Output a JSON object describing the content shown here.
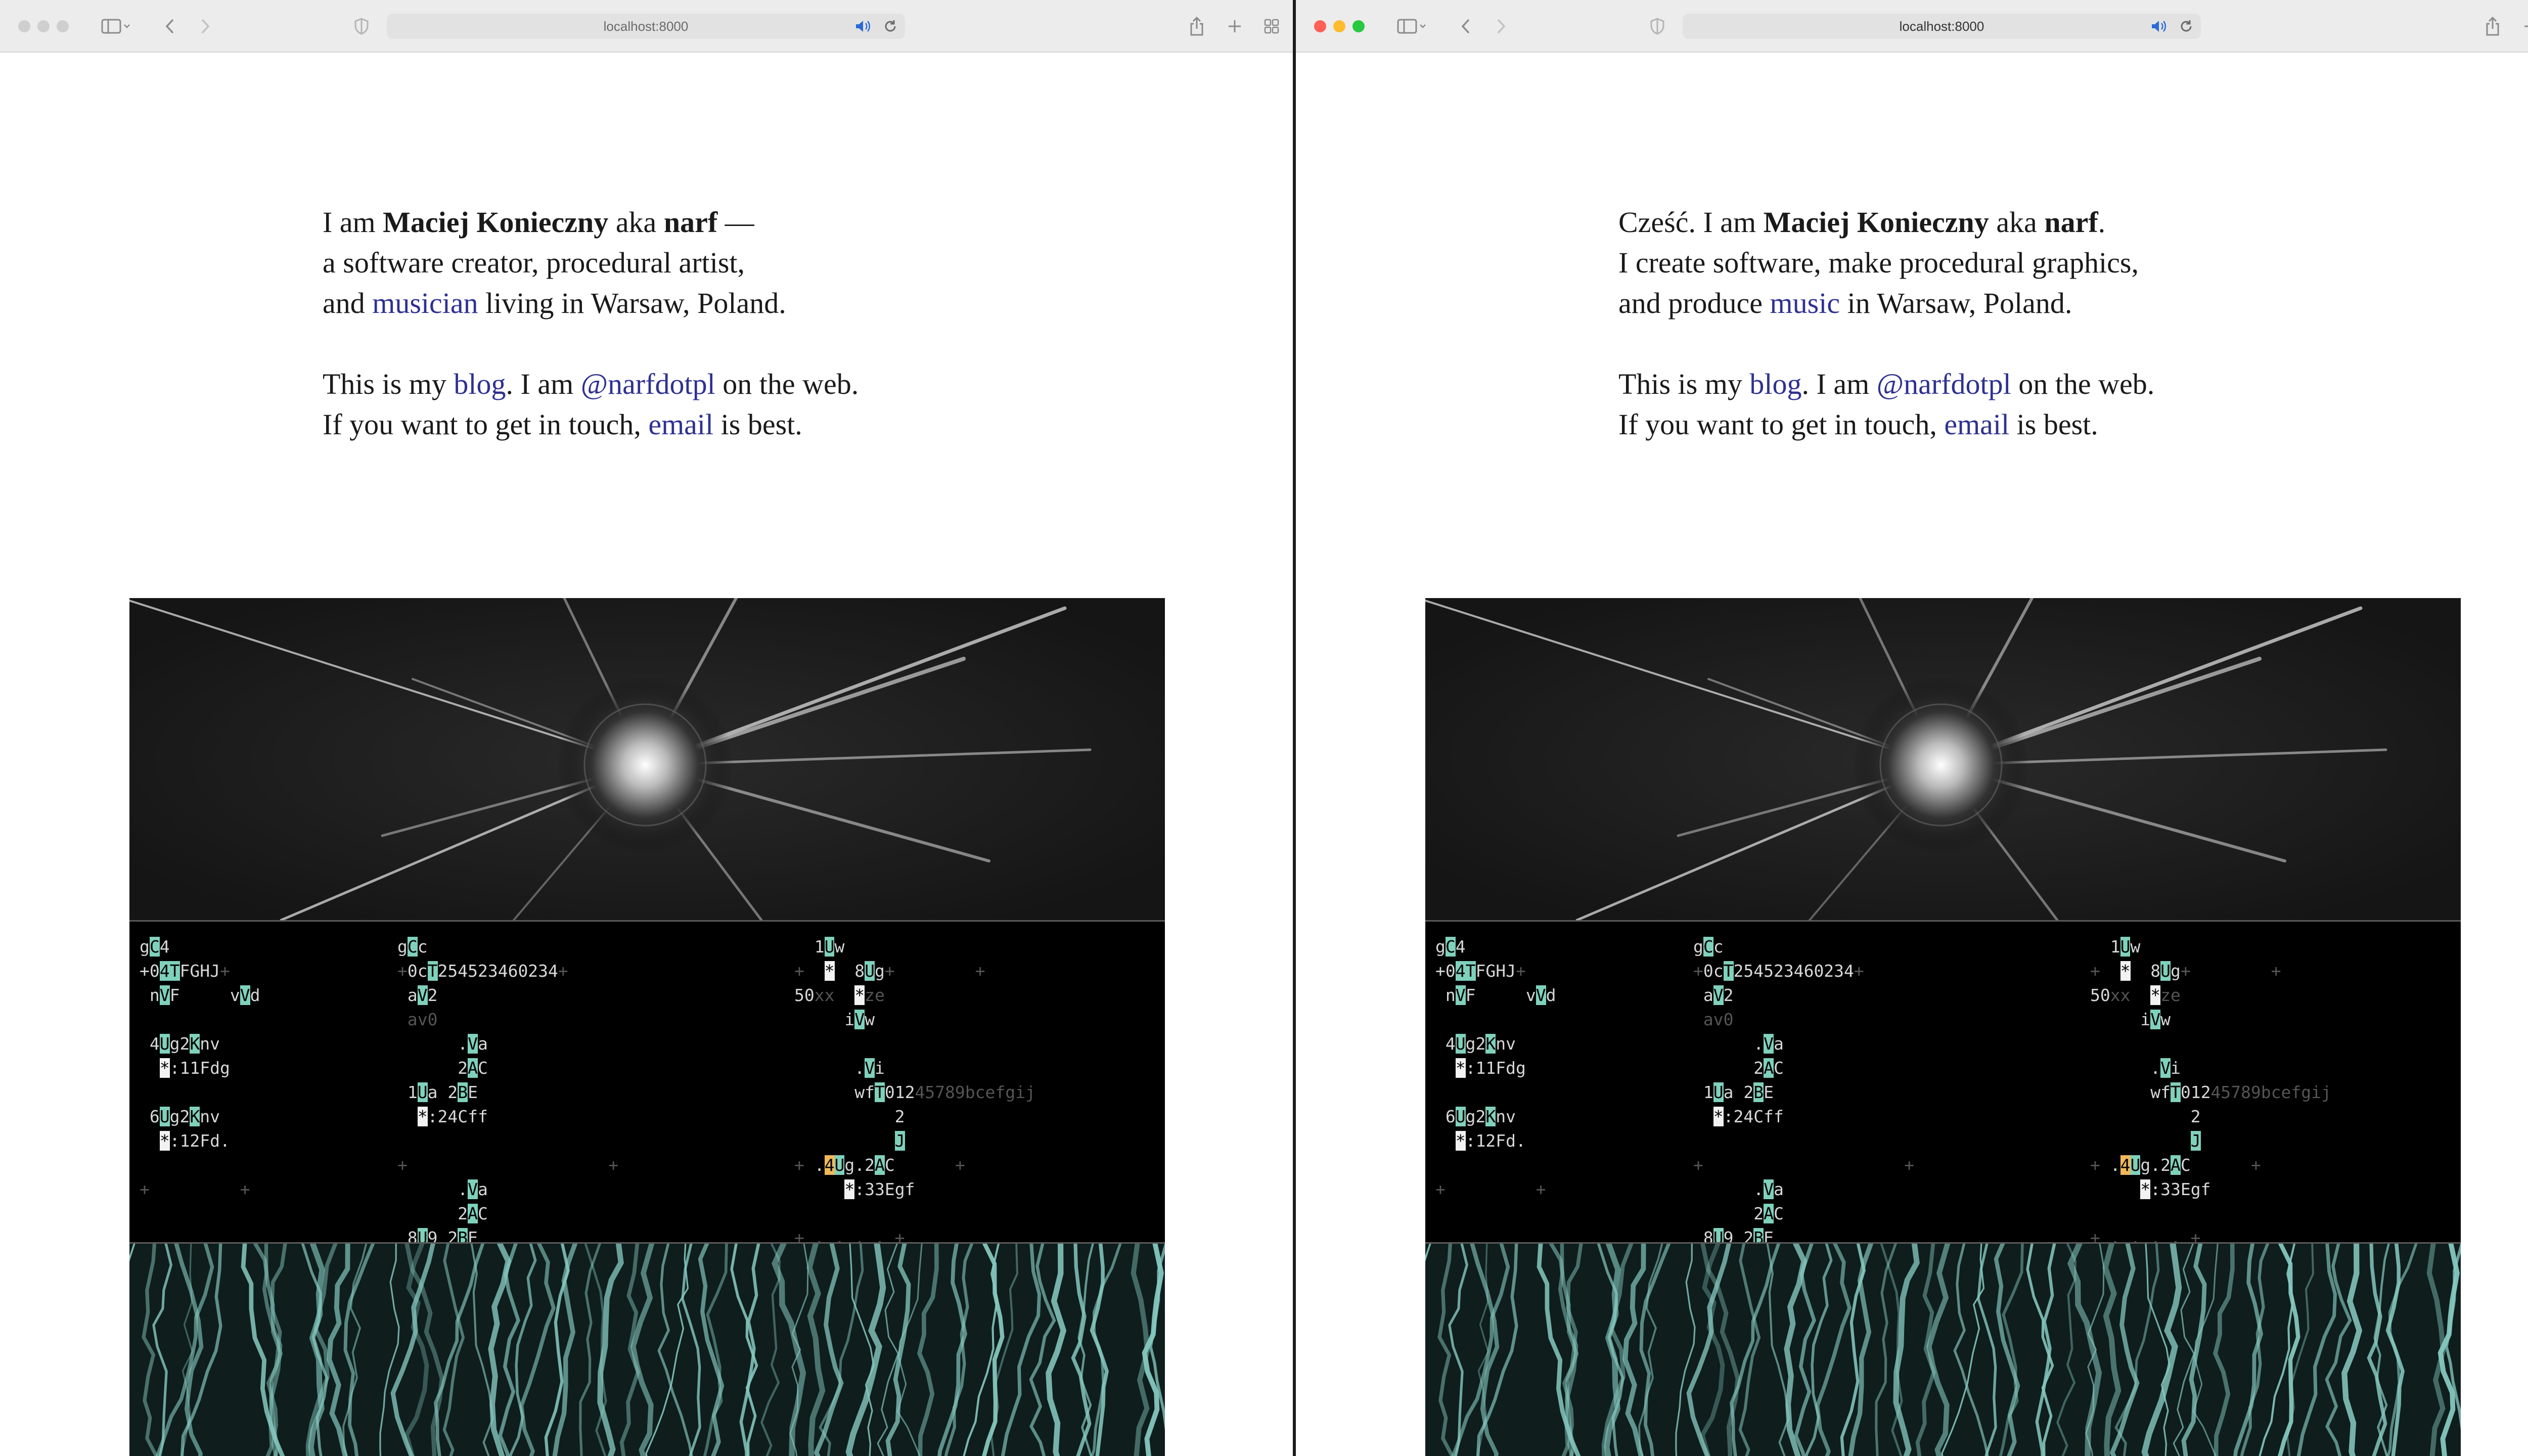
{
  "windows": [
    {
      "url": "localhost:8000",
      "intro": {
        "l1a": "I am ",
        "name": "Maciej Konieczny",
        "l1b": " aka ",
        "nick": "narf",
        "l1c": " —",
        "l2": "a software creator, procedural artist,",
        "l3a": "and ",
        "link1": "musician",
        "l3b": " living in Warsaw, Poland.",
        "l4a": "This is my ",
        "blog": "blog",
        "l4b": ". I am ",
        "handle": "@narfdotpl",
        "l4c": " on the web.",
        "l5a": "If you want to get in touch, ",
        "email": "email",
        "l5b": " is best."
      }
    },
    {
      "url": "localhost:8000",
      "intro": {
        "l1a": "Cześć. I am ",
        "name": "Maciej Konieczny",
        "l1b": " aka ",
        "nick": "narf",
        "l1c": ".",
        "l2": "I create software, make procedural graphics,",
        "l3a": "and produce ",
        "link1": "music",
        "l3b": " in Warsaw, Poland.",
        "l4a": "This is my ",
        "blog": "blog",
        "l4b": ". I am ",
        "handle": "@narfdotpl",
        "l4c": " on the web.",
        "l5a": "If you want to get in touch, ",
        "email": "email",
        "l5b": " is best."
      }
    }
  ],
  "icons": {
    "sidebar": "sidebar-icon",
    "back": "back-icon",
    "forward": "forward-icon",
    "privacy": "shield-icon",
    "audio": "speaker-icon",
    "reload": "reload-icon",
    "share": "share-icon",
    "newtab": "plus-icon",
    "tabs": "tab-overview-icon"
  },
  "colors": {
    "link": "#2e3191",
    "orca_cell": "#7fd1bc",
    "orca_accent": "#f0b85a",
    "bark": "#86c9c0"
  }
}
